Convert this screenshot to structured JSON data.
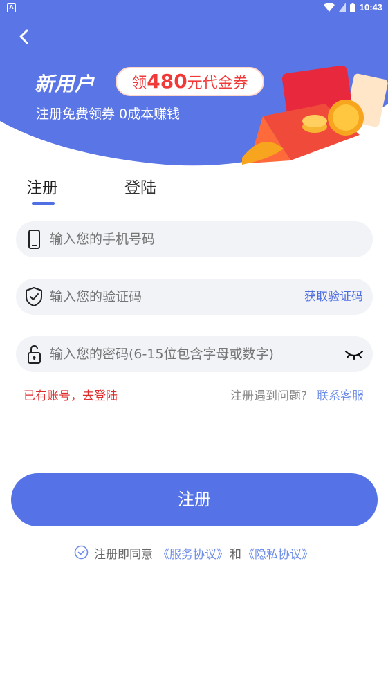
{
  "status_bar": {
    "left_icon": "A",
    "time": "10:43",
    "icons": [
      "wifi-icon",
      "sim-icon",
      "battery-icon"
    ]
  },
  "header": {
    "back_icon": "chevron-left-icon",
    "promo_title": "新用户",
    "promo_badge_prefix": "领",
    "promo_badge_amount": "480",
    "promo_badge_suffix": "元代金券",
    "promo_subtitle": "注册免费领券 0成本赚钱",
    "colors": {
      "background": "#5a75e6",
      "badge_text": "#f03a3a"
    }
  },
  "tabs": [
    {
      "label": "注册",
      "active": true
    },
    {
      "label": "登陆",
      "active": false
    }
  ],
  "form": {
    "phone_placeholder": "输入您的手机号码",
    "code_placeholder": "输入您的验证码",
    "get_code_label": "获取验证码",
    "password_placeholder": "输入您的密码(6-15位包含字母或数字)"
  },
  "links": {
    "has_account": "已有账号，去登陆",
    "problem_text": "注册遇到问题?",
    "contact_service": "联系客服"
  },
  "register_button": "注册",
  "agreement": {
    "prefix": "注册即同意",
    "service_link": "《服务协议》",
    "and": "和",
    "privacy_link": "《隐私协议》"
  },
  "colors": {
    "primary": "#5573e6",
    "link": "#6f8ee8",
    "error": "#e02b2b",
    "input_bg": "#f2f3f7"
  }
}
